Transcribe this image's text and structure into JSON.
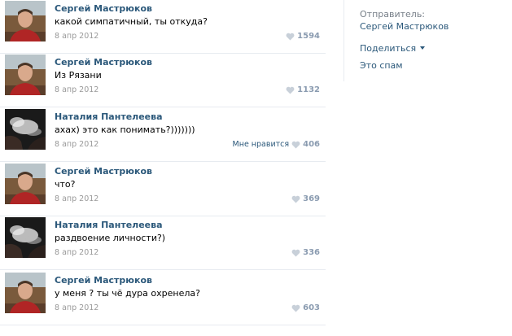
{
  "comments": [
    {
      "author": "Сергей Мастрюков",
      "text": "какой симпатичный, ты откуда?",
      "date": "8 апр 2012",
      "likes": "1594",
      "like_label": "",
      "avatar": "man-avatar"
    },
    {
      "author": "Сергей Мастрюков",
      "text": "Из Рязани",
      "date": "8 апр 2012",
      "likes": "1132",
      "like_label": "",
      "avatar": "man-avatar"
    },
    {
      "author": "Наталия Пантелеева",
      "text": "ахах) это как понимать?)))))))",
      "date": "8 апр 2012",
      "likes": "406",
      "like_label": "Мне нравится",
      "avatar": "smoke-avatar"
    },
    {
      "author": "Сергей Мастрюков",
      "text": "что?",
      "date": "8 апр 2012",
      "likes": "369",
      "like_label": "",
      "avatar": "man-avatar"
    },
    {
      "author": "Наталия Пантелеева",
      "text": "раздвоение личности?)",
      "date": "8 апр 2012",
      "likes": "336",
      "like_label": "",
      "avatar": "smoke-avatar"
    },
    {
      "author": "Сергей Мастрюков",
      "text": "у меня ? ты чё дура охренела?",
      "date": "8 апр 2012",
      "likes": "603",
      "like_label": "",
      "avatar": "man-avatar"
    }
  ],
  "sidebar": {
    "sender_label": "Отправитель:",
    "sender_name": "Сергей Мастрюков",
    "share_label": "Поделиться",
    "spam_label": "Это спам"
  },
  "colors": {
    "link": "#2b587a",
    "muted": "#999999",
    "like_count": "#8a9bb0",
    "separator": "#e7ebf0"
  }
}
